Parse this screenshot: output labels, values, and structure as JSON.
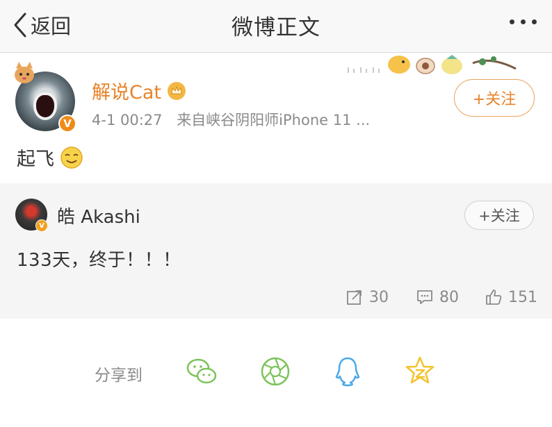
{
  "nav": {
    "back_label": "返回",
    "title": "微博正文"
  },
  "post": {
    "username": "解说Cat",
    "time": "4-1 00:27",
    "source": "来自峡谷阴阳师iPhone 11 ...",
    "follow_label": "+关注",
    "text": "起飞"
  },
  "repost": {
    "username": "皓 Akashi",
    "follow_label": "+关注",
    "text": "133天，终于！！！",
    "shares": "30",
    "comments": "80",
    "likes": "151"
  },
  "share": {
    "label": "分享到",
    "targets": [
      "wechat",
      "wechat-moments",
      "qq",
      "qzone"
    ]
  },
  "colors": {
    "accent_orange": "#e8832a",
    "muted": "#8a8a8a",
    "wechat_green": "#7cc35a",
    "qq_blue": "#4aa8e8",
    "qzone_yellow": "#f3c22a"
  }
}
